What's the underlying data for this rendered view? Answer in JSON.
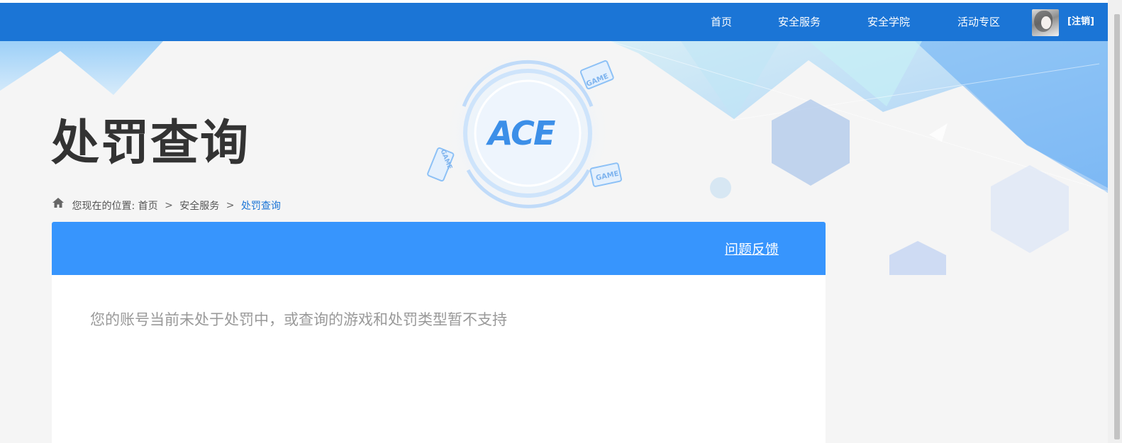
{
  "nav": {
    "items": [
      {
        "label": "首页"
      },
      {
        "label": "安全服务"
      },
      {
        "label": "安全学院"
      },
      {
        "label": "活动专区"
      }
    ],
    "logout_label": "[注销]"
  },
  "banner": {
    "logo_text": "ACE",
    "game_tag": "GAME"
  },
  "page": {
    "title": "处罚查询"
  },
  "breadcrumb": {
    "prefix": "您现在的位置:",
    "items": [
      "首页",
      "安全服务",
      "处罚查询"
    ],
    "separator": ">"
  },
  "panel": {
    "feedback_label": "问题反馈",
    "message": "您的账号当前未处于处罚中，或查询的游戏和处罚类型暂不支持"
  },
  "colors": {
    "nav_bg": "#1b75d6",
    "panel_head": "#3795fd",
    "title": "#333333",
    "breadcrumb_active": "#1b75d6",
    "message": "#999999"
  },
  "icons": {
    "breadcrumb_home": "home-icon",
    "user_avatar": "avatar"
  }
}
